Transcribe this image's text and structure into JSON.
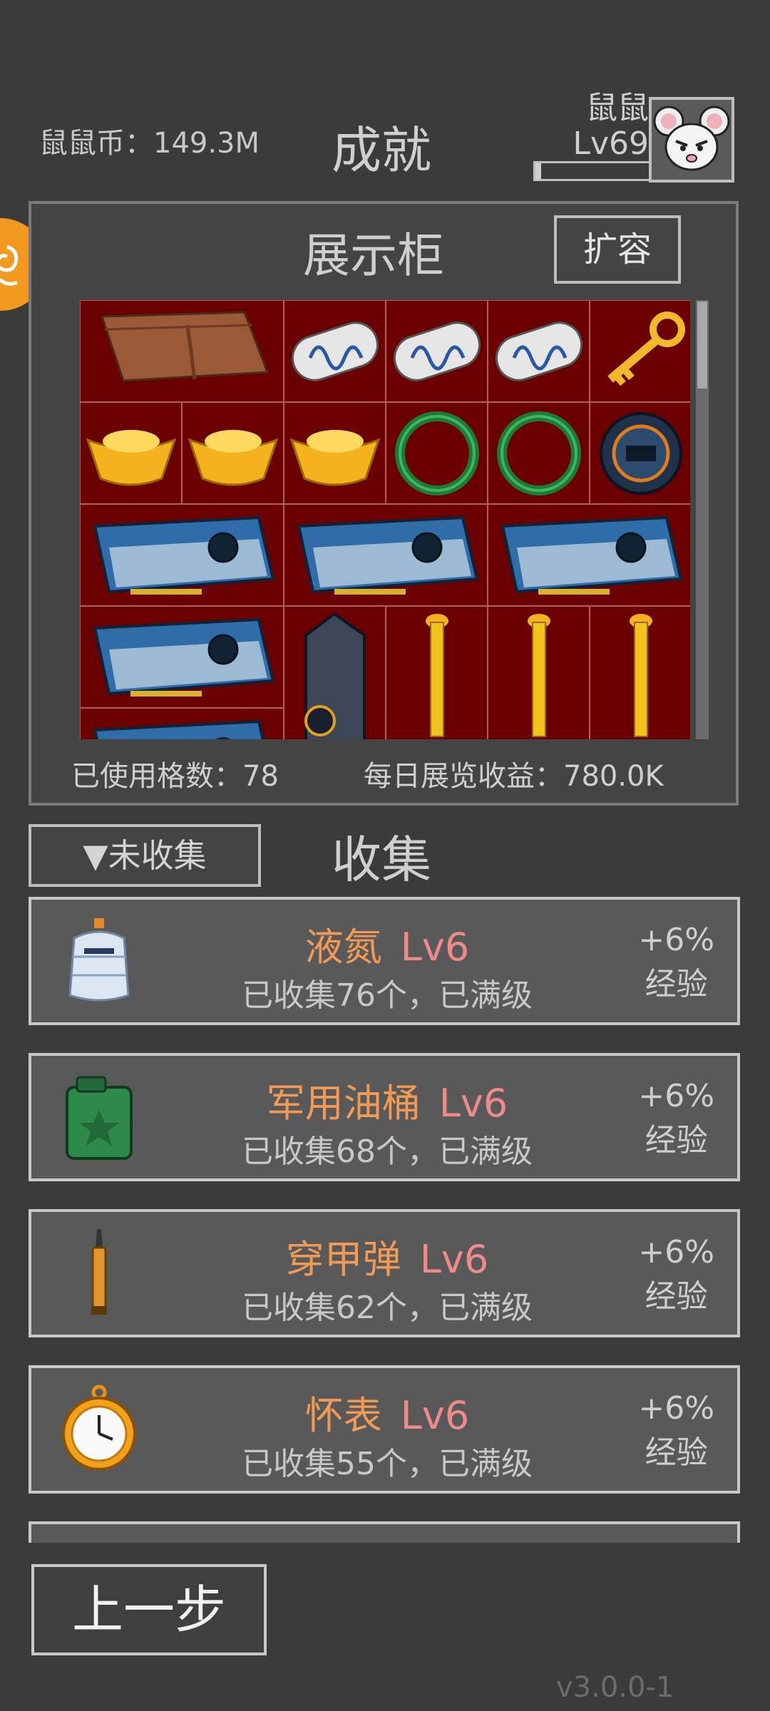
{
  "header": {
    "coins": "鼠鼠币：149.3M",
    "title": "成就",
    "profile_name": "鼠鼠",
    "profile_level": "Lv69",
    "xp_progress": 0.05
  },
  "showcase": {
    "title": "展示柜",
    "expand_label": "扩容",
    "used_cells": "已使用格数：78",
    "daily_income": "每日展览收益：780.0K",
    "items": [
      "leather-wallet",
      "dna-capsule",
      "dna-capsule",
      "dna-capsule",
      "golden-key",
      "gold-ingot",
      "gold-ingot",
      "gold-ingot",
      "jade-bracelet",
      "jade-bracelet",
      "smart-watch",
      "graphics-card",
      "graphics-card",
      "graphics-card",
      "graphics-card",
      "charging-dock",
      "golden-candlestick",
      "golden-candlestick",
      "golden-candlestick",
      "graphics-card"
    ]
  },
  "collection": {
    "filter_label": "▼未收集",
    "title": "收集",
    "items": [
      {
        "icon": "liquid-nitrogen-tank-icon",
        "name": "液氮",
        "level": "Lv6",
        "sub": "已收集76个，已满级",
        "bonus": "+6%",
        "bonus_label": "经验"
      },
      {
        "icon": "military-fuel-can-icon",
        "name": "军用油桶",
        "level": "Lv6",
        "sub": "已收集68个，已满级",
        "bonus": "+6%",
        "bonus_label": "经验"
      },
      {
        "icon": "armor-piercing-round-icon",
        "name": "穿甲弹",
        "level": "Lv6",
        "sub": "已收集62个，已满级",
        "bonus": "+6%",
        "bonus_label": "经验"
      },
      {
        "icon": "pocket-watch-icon",
        "name": "怀表",
        "level": "Lv6",
        "sub": "已收集55个，已满级",
        "bonus": "+6%",
        "bonus_label": "经验"
      }
    ]
  },
  "footer": {
    "back_label": "上一步",
    "version": "v3.0.0-1"
  },
  "colors": {
    "background": "#3b3b3b",
    "cabinet_red": "#6a0000",
    "item_name": "#f19a55",
    "item_level": "#ef8a8a",
    "side_button": "#f29a1f"
  }
}
